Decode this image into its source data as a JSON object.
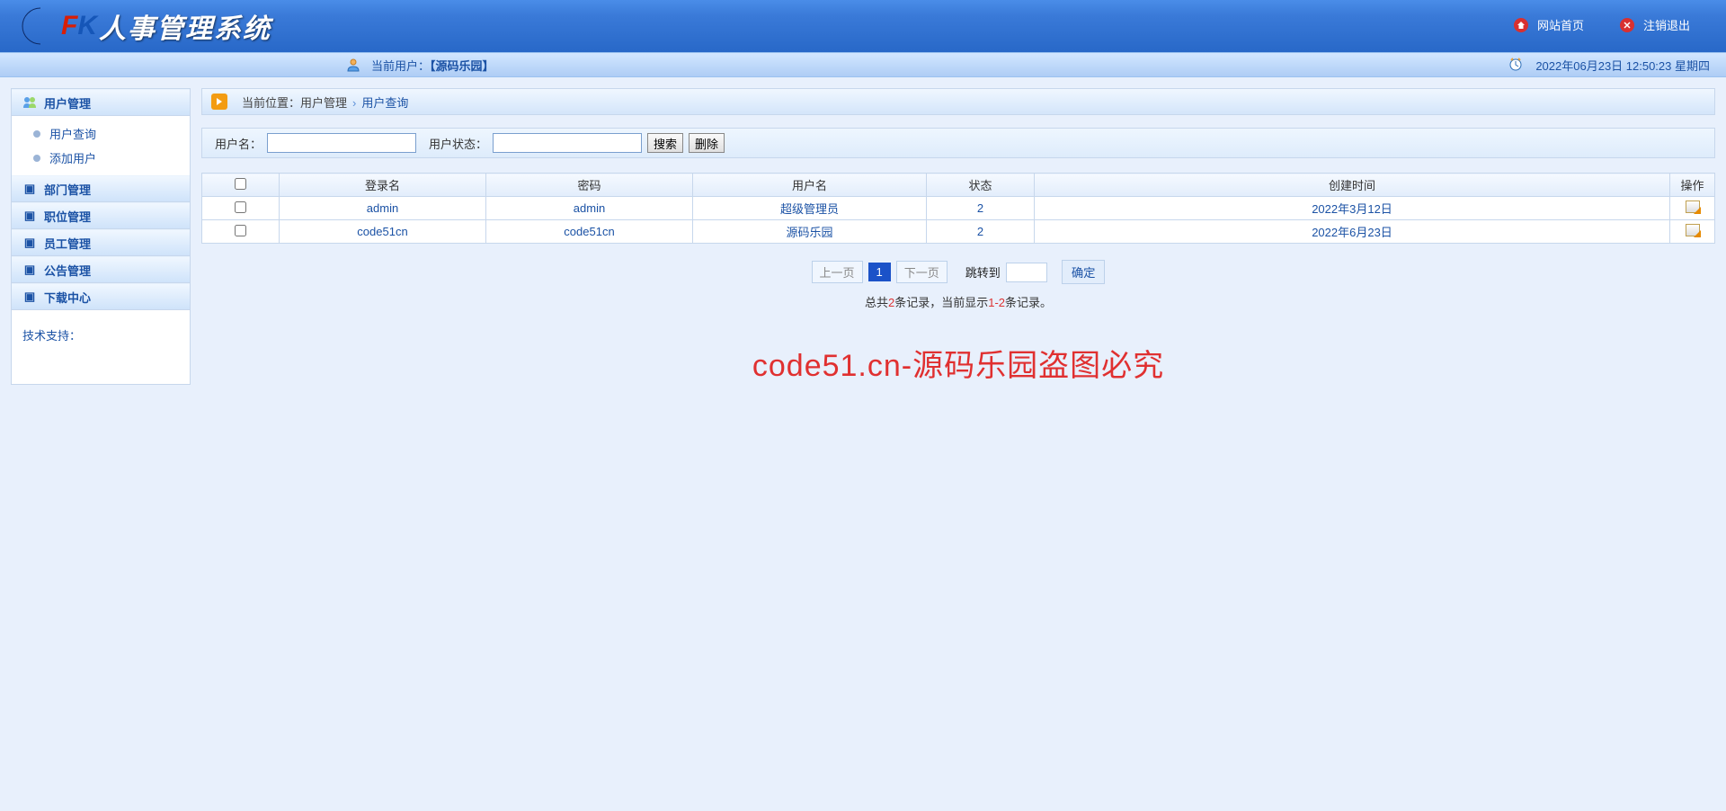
{
  "header": {
    "system_title": "人事管理系统",
    "links": {
      "home": "网站首页",
      "logout": "注销退出"
    }
  },
  "subheader": {
    "current_user_label": "当前用户：",
    "current_user_name": "【源码乐园】",
    "datetime_text": "2022年06月23日 12:50:23 星期四"
  },
  "sidebar": {
    "sections": [
      {
        "title": "用户管理",
        "items": [
          "用户查询",
          "添加用户"
        ]
      },
      {
        "title": "部门管理",
        "items": []
      },
      {
        "title": "职位管理",
        "items": []
      },
      {
        "title": "员工管理",
        "items": []
      },
      {
        "title": "公告管理",
        "items": []
      },
      {
        "title": "下载中心",
        "items": []
      }
    ],
    "support_label": "技术支持："
  },
  "breadcrumb": {
    "prefix": "当前位置：",
    "parent": "用户管理",
    "leaf": "用户查询"
  },
  "search": {
    "user_label": "用户名：",
    "status_label": "用户状态：",
    "search_btn": "搜索",
    "delete_btn": "删除"
  },
  "table": {
    "headers": {
      "login": "登录名",
      "password": "密码",
      "username": "用户名",
      "status": "状态",
      "created": "创建时间",
      "op": "操作"
    },
    "rows": [
      {
        "login": "admin",
        "password": "admin",
        "username": "超级管理员",
        "status": "2",
        "created": "2022年3月12日"
      },
      {
        "login": "code51cn",
        "password": "code51cn",
        "username": "源码乐园",
        "status": "2",
        "created": "2022年6月23日"
      }
    ]
  },
  "pager": {
    "prev": "上一页",
    "current": "1",
    "next": "下一页",
    "jump_label": "跳转到",
    "jump_ok": "确定"
  },
  "records": {
    "prefix": "总共",
    "total": "2",
    "mid": "条记录，当前显示",
    "range": "1-2",
    "suffix": "条记录。"
  },
  "watermark": "code51.cn-源码乐园盗图必究"
}
